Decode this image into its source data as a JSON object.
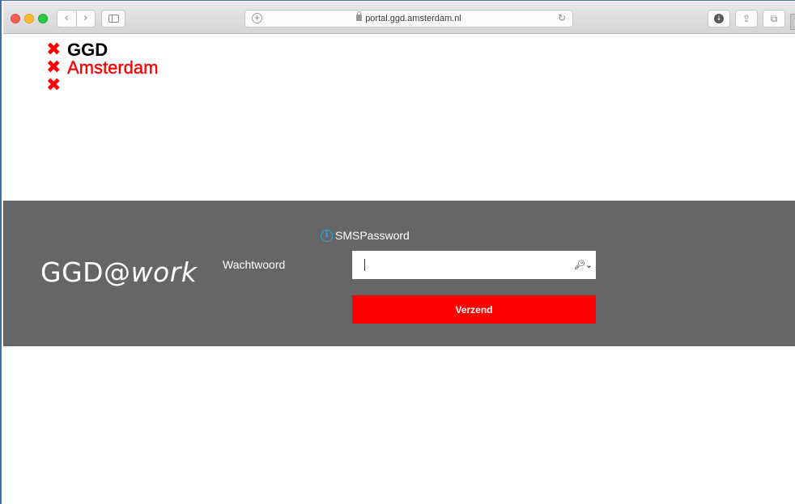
{
  "browser": {
    "url": "portal.ggd.amsterdam.nl",
    "icons": {
      "back": "chevron-left-icon",
      "forward": "chevron-right-icon",
      "sidebar": "sidebar-icon",
      "lock": "lock-icon",
      "reload": "reload-icon",
      "download": "download-icon",
      "share": "share-icon",
      "tabs": "tabs-icon"
    }
  },
  "logo": {
    "line1": "GGD",
    "line2": "Amsterdam",
    "mark": "✖",
    "colors": {
      "red": "#ff0000",
      "black": "#000000"
    }
  },
  "login": {
    "brand_prefix": "GGD@",
    "brand_suffix": "work",
    "method": "SMSPassword",
    "password_label": "Wachtwoord",
    "password_value": "",
    "submit_label": "Verzend",
    "colors": {
      "band": "#666666",
      "button": "#ff0000",
      "info": "#29a6e0"
    }
  }
}
